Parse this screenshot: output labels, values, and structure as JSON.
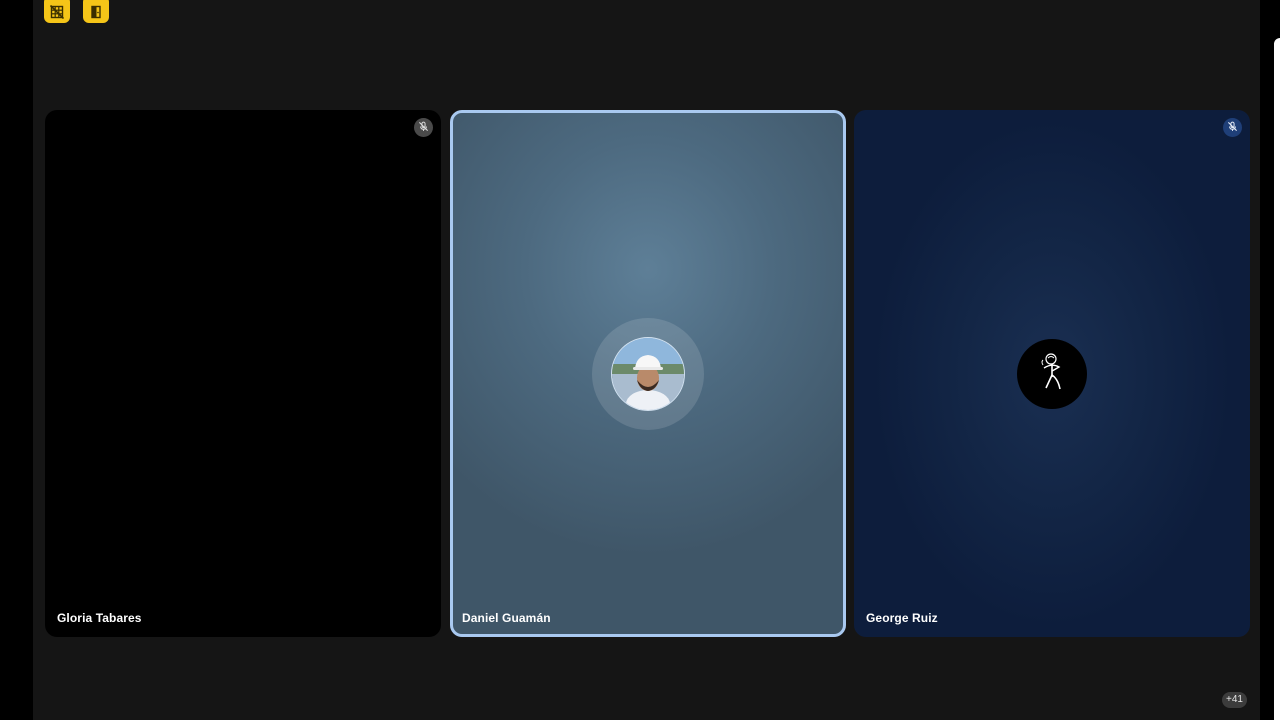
{
  "toolbar": {
    "buttons": [
      {
        "icon": "grid-off-icon",
        "color": "#f5c518"
      },
      {
        "icon": "door-exit-icon",
        "color": "#f5c518"
      }
    ]
  },
  "participants": [
    {
      "name": "Gloria Tabares",
      "muted": true,
      "tile_color": "#000000"
    },
    {
      "name": "Daniel Guamán",
      "muted": false,
      "speaking": true,
      "avatar": "photo",
      "highlight_color": "#a9c9f0"
    },
    {
      "name": "George Ruiz",
      "muted": true,
      "avatar": "logo",
      "tile_color": "#0d1d3c"
    }
  ],
  "overflow_count": "+41"
}
